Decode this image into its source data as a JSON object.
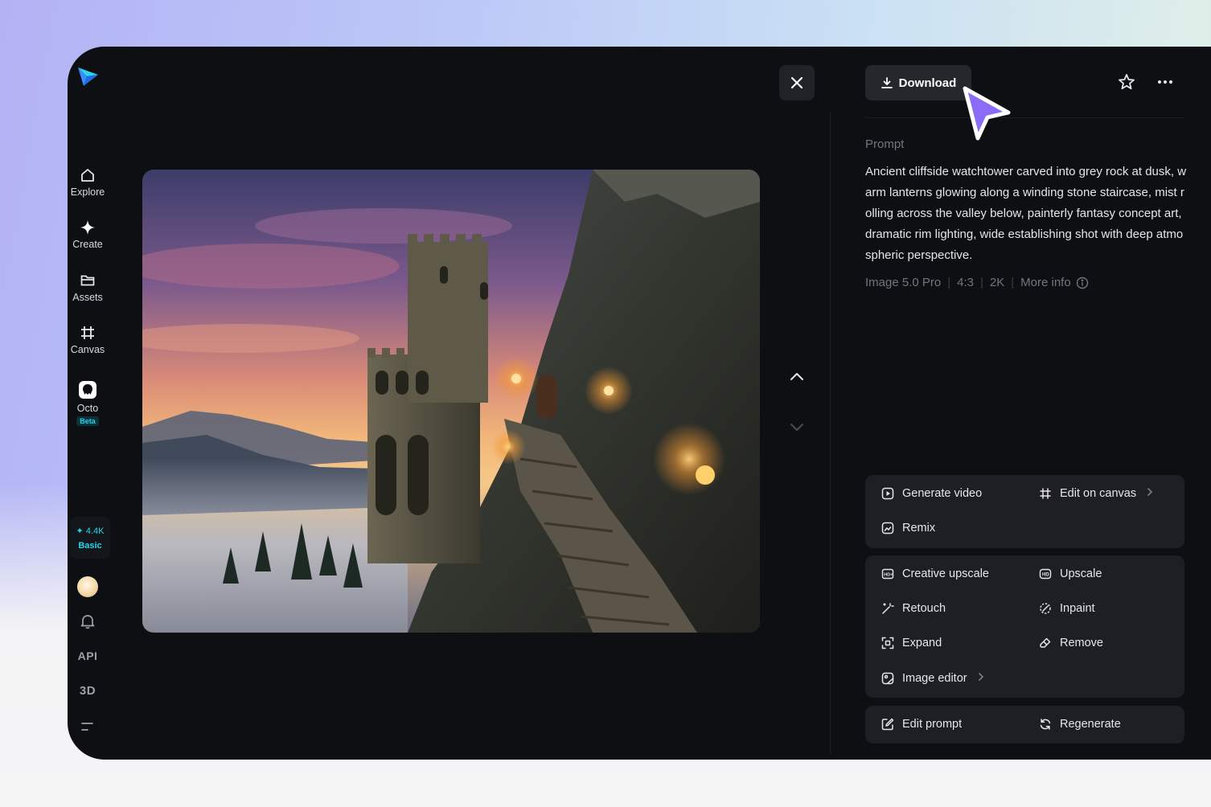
{
  "colors": {
    "window_bg": "#0e0f13",
    "card_bg": "#1d1f24",
    "accent_cyan": "#22d3e6",
    "cursor_purple": "#8b6cf6"
  },
  "sidebar": {
    "nav": [
      {
        "label": "Explore",
        "icon": "home-icon"
      },
      {
        "label": "Create",
        "icon": "sparkle-icon"
      },
      {
        "label": "Assets",
        "icon": "folder-icon"
      },
      {
        "label": "Canvas",
        "icon": "frame-icon"
      },
      {
        "label": "Octo",
        "icon": "octo-icon",
        "badge": "Beta"
      }
    ],
    "credits": {
      "amount": "✦ 4.4K",
      "tier": "Basic"
    },
    "api_label": "API",
    "three_d_label": "3D"
  },
  "header": {
    "download_label": "Download"
  },
  "prompt": {
    "label": "Prompt",
    "text": "Ancient cliffside watchtower carved into grey rock at dusk, warm lanterns glowing along a winding stone staircase, mist rolling across the valley below, painterly fantasy concept art, dramatic rim lighting, wide establishing shot with deep atmospheric perspective.",
    "model": "Image 5.0 Pro",
    "ratio": "4:3",
    "resolution": "2K",
    "more_info": "More info"
  },
  "actions": {
    "group1": [
      {
        "label": "Generate video",
        "icon": "play-icon"
      },
      {
        "label": "Edit on canvas",
        "icon": "frame-icon"
      },
      {
        "label": "Remix",
        "icon": "remix-icon"
      }
    ],
    "group2": [
      {
        "label": "Creative upscale",
        "icon": "hd-plus-icon"
      },
      {
        "label": "Upscale",
        "icon": "hd-icon"
      },
      {
        "label": "Retouch",
        "icon": "magic-wand-icon"
      },
      {
        "label": "Inpaint",
        "icon": "inpaint-icon"
      },
      {
        "label": "Expand",
        "icon": "expand-icon"
      },
      {
        "label": "Remove",
        "icon": "eraser-icon"
      },
      {
        "label": "Image editor",
        "icon": "image-editor-icon"
      }
    ],
    "group3": [
      {
        "label": "Edit prompt",
        "icon": "edit-icon"
      },
      {
        "label": "Regenerate",
        "icon": "refresh-icon"
      }
    ]
  }
}
